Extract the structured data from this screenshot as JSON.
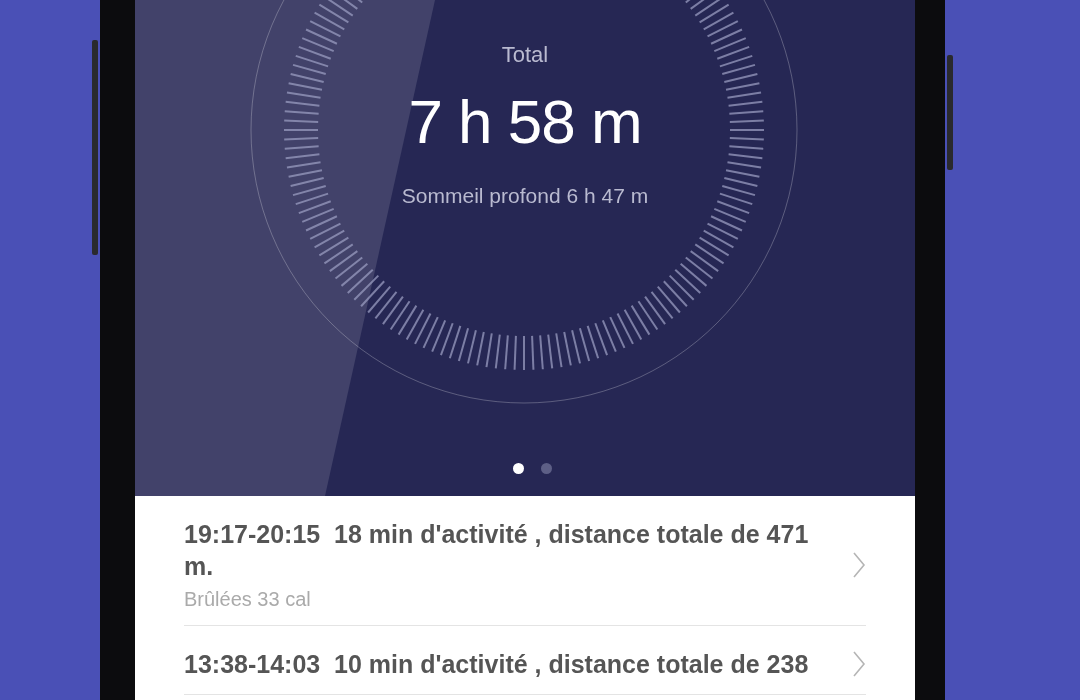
{
  "summary": {
    "label": "Total",
    "value": "7 h 58 m",
    "detail": "Sommeil profond 6 h 47 m",
    "pages": [
      {
        "selected": true
      },
      {
        "selected": false
      }
    ]
  },
  "activities": [
    {
      "title": "19:17-20:15  18 min d'activité , distance totale de 471 m.",
      "subtitle": "Brûlées 33 cal"
    },
    {
      "title": "13:38-14:03  10 min d'activité , distance totale de 238"
    }
  ]
}
